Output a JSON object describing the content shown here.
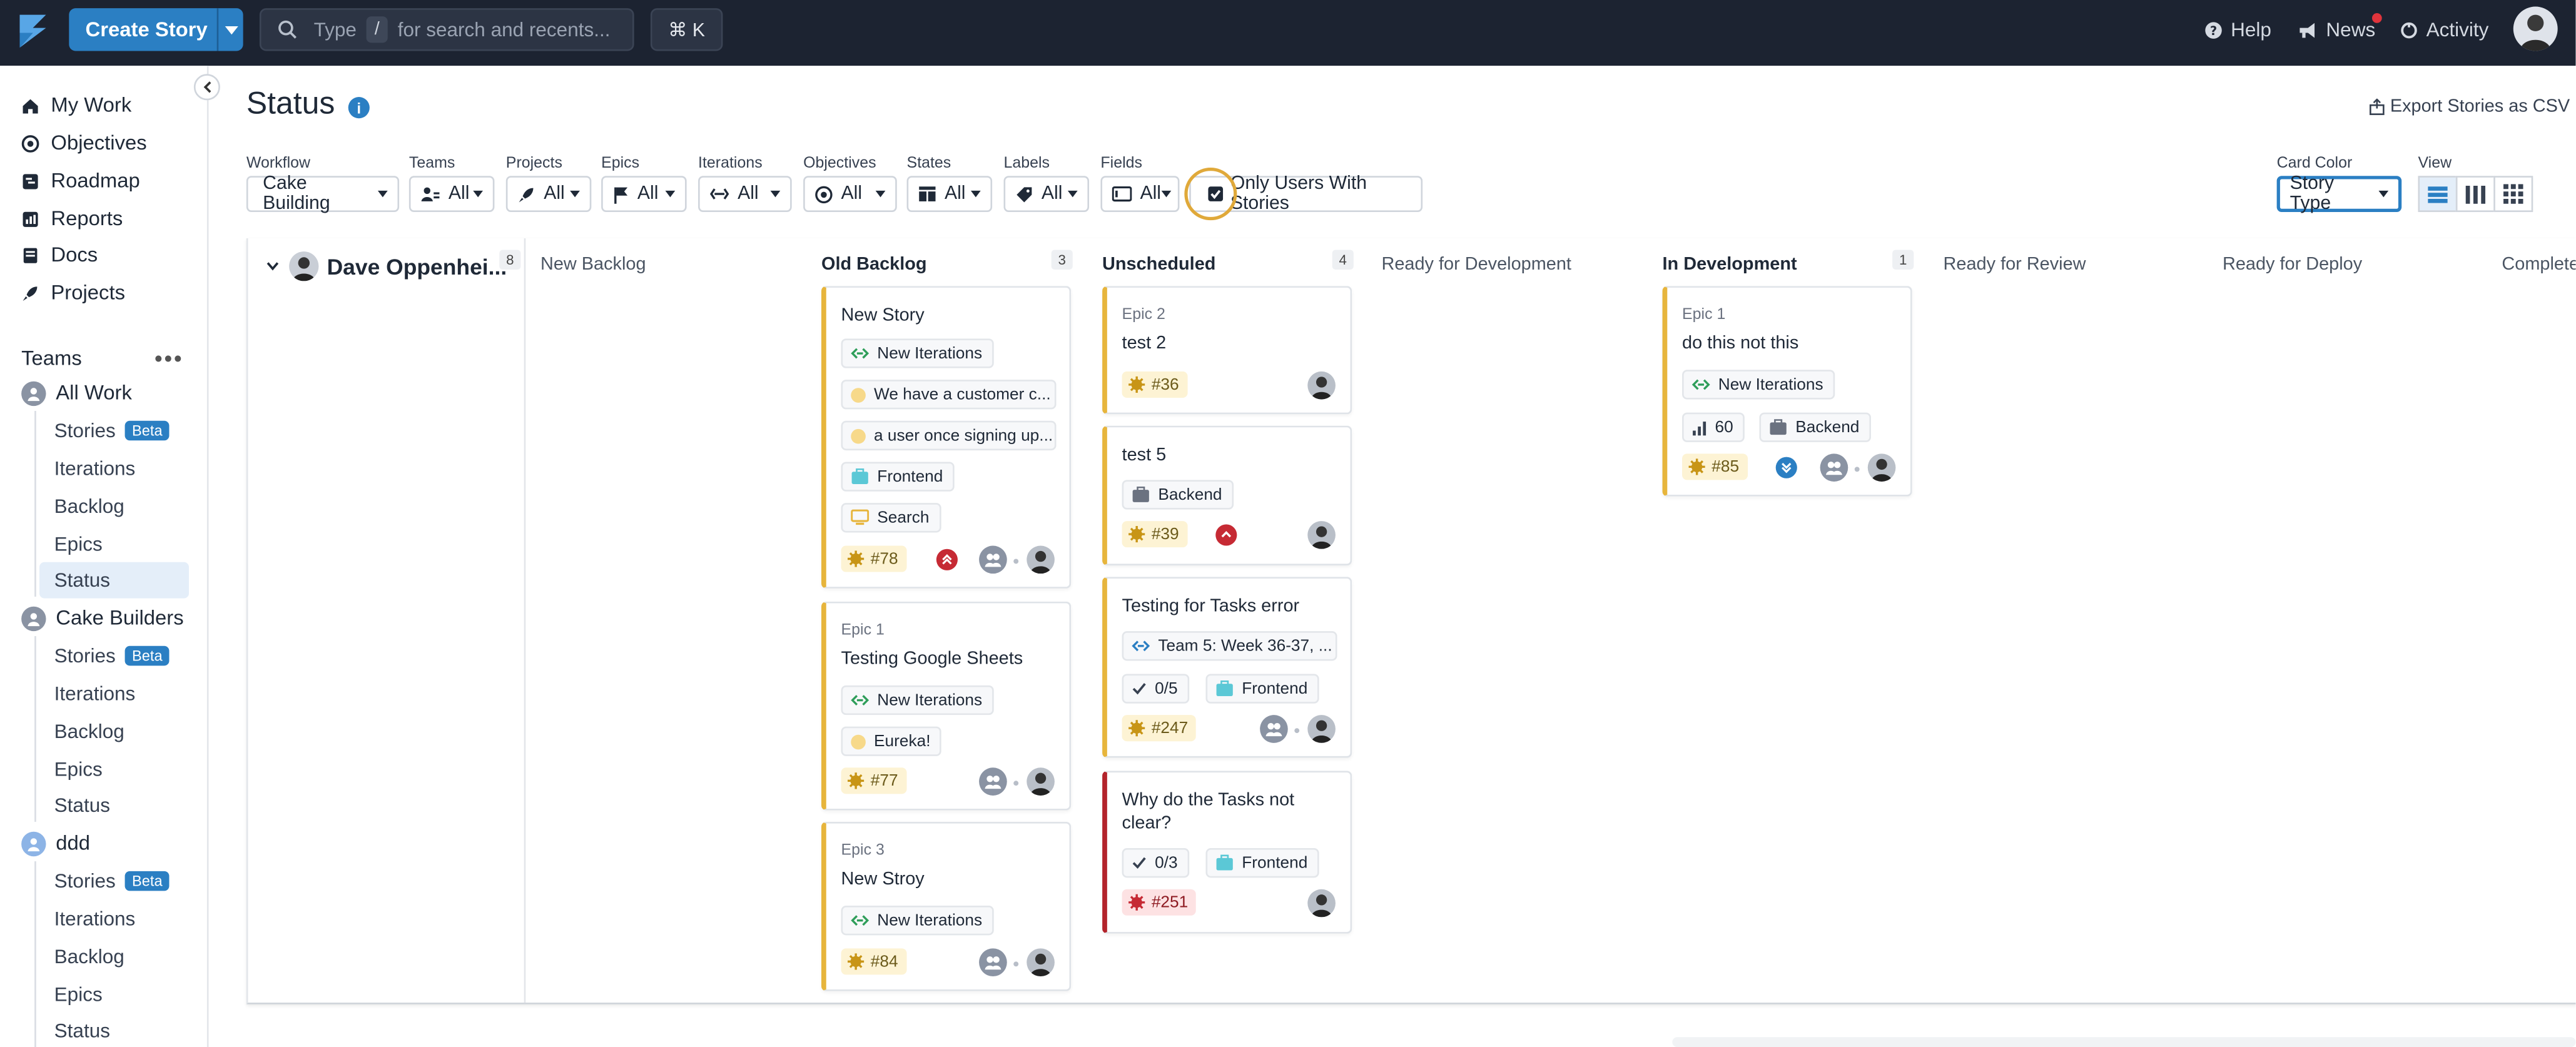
{
  "topbar": {
    "create_label": "Create Story",
    "search_type": "Type",
    "search_slash": "/",
    "search_hint": "for search and recents...",
    "shortcut": "⌘ K",
    "help": "Help",
    "news": "News",
    "activity": "Activity"
  },
  "sidebar": {
    "main_items": [
      {
        "label": "My Work",
        "icon": "home-icon"
      },
      {
        "label": "Objectives",
        "icon": "target-icon"
      },
      {
        "label": "Roadmap",
        "icon": "roadmap-icon"
      },
      {
        "label": "Reports",
        "icon": "chart-icon"
      },
      {
        "label": "Docs",
        "icon": "book-icon"
      },
      {
        "label": "Projects",
        "icon": "rocket-icon"
      }
    ],
    "teams_heading": "Teams",
    "teams_more": "•••",
    "teams": [
      {
        "name": "All Work",
        "items": [
          "Stories",
          "Iterations",
          "Backlog",
          "Epics",
          "Status"
        ]
      },
      {
        "name": "Cake Builders",
        "items": [
          "Stories",
          "Iterations",
          "Backlog",
          "Epics",
          "Status"
        ]
      },
      {
        "name": "ddd",
        "items": [
          "Stories",
          "Iterations",
          "Backlog",
          "Epics",
          "Status"
        ]
      }
    ],
    "beta_label": "Beta",
    "active_item": "Status"
  },
  "header": {
    "title": "Status",
    "info": "i",
    "export": "Export Stories as CSV"
  },
  "filters": {
    "workflow": {
      "label": "Workflow",
      "value": "Cake Building"
    },
    "teams": {
      "label": "Teams",
      "value": "All"
    },
    "projects": {
      "label": "Projects",
      "value": "All"
    },
    "epics": {
      "label": "Epics",
      "value": "All"
    },
    "iterations": {
      "label": "Iterations",
      "value": "All"
    },
    "objectives": {
      "label": "Objectives",
      "value": "All"
    },
    "states": {
      "label": "States",
      "value": "All"
    },
    "labels": {
      "label": "Labels",
      "value": "All"
    },
    "fields": {
      "label": "Fields",
      "value": "All"
    },
    "only_users": "Only Users With Stories",
    "card_color": {
      "label": "Card Color",
      "value": "Story Type"
    },
    "view": {
      "label": "View",
      "active": "list"
    }
  },
  "board": {
    "owner": "Dave Oppenhei...",
    "owner_count": "8",
    "columns": [
      {
        "name": "New Backlog",
        "count": ""
      },
      {
        "name": "Old Backlog",
        "count": "3"
      },
      {
        "name": "Unscheduled",
        "count": "4"
      },
      {
        "name": "Ready for Development",
        "count": ""
      },
      {
        "name": "In Development",
        "count": "1"
      },
      {
        "name": "Ready for Review",
        "count": ""
      },
      {
        "name": "Ready for Deploy",
        "count": ""
      },
      {
        "name": "Complete",
        "count": ""
      }
    ]
  },
  "cards": {
    "c1": {
      "title": "New Story",
      "iteration": "New Iterations",
      "label1": "We have a customer c...",
      "label2": "a user once signing up...",
      "group": "Frontend",
      "field": "Search",
      "id": "#78",
      "priority": "highest"
    },
    "c2": {
      "epic": "Epic 1",
      "title": "Testing Google Sheets",
      "iteration": "New Iterations",
      "label1": "Eureka!",
      "id": "#77"
    },
    "c3": {
      "epic": "Epic 3",
      "title": "New Stroy",
      "iteration": "New Iterations",
      "id": "#84"
    },
    "c4": {
      "epic": "Epic 2",
      "title": "test 2",
      "id": "#36"
    },
    "c5": {
      "title": "test 5",
      "group": "Backend",
      "id": "#39",
      "priority": "high"
    },
    "c6": {
      "title": "Testing for Tasks error",
      "iteration": "Team 5: Week 36-37, ...",
      "tasks": "0/5",
      "group": "Frontend",
      "id": "#247"
    },
    "c7": {
      "title": "Why do the Tasks not clear?",
      "tasks": "0/3",
      "group": "Frontend",
      "id": "#251",
      "type": "bug"
    },
    "c8": {
      "epic": "Epic 1",
      "title": "do this not this",
      "iteration": "New Iterations",
      "estimate": "60",
      "group": "Backend",
      "id": "#85",
      "priority": "low"
    }
  },
  "colors": {
    "topbar": "#1c2331",
    "accent": "#2b7fc3",
    "feature": "#e7b53c",
    "bug": "#b3232b"
  }
}
